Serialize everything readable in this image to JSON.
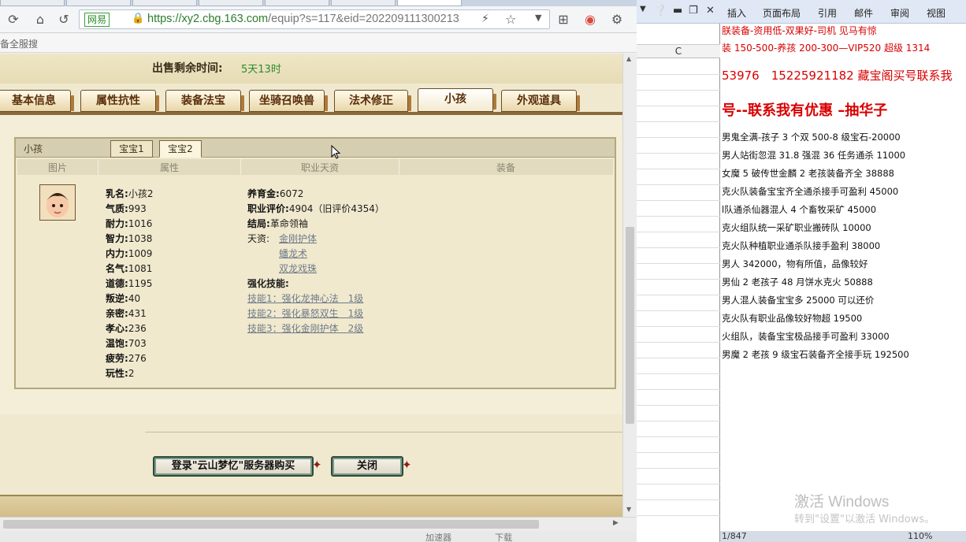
{
  "browser": {
    "url_site": "网易",
    "url_host": "https://xy2.cbg.163.com",
    "url_path": "/equip?s=117&eid=202209111300213",
    "fav_text": "备全服搜",
    "status_left": "加速器",
    "status_mid": "下载"
  },
  "sale": {
    "time_label": "出售剩余时间:",
    "time_value": "5天13时"
  },
  "tabs": [
    "基本信息",
    "属性抗性",
    "装备法宝",
    "坐骑召唤兽",
    "法术修正",
    "小孩",
    "外观道具"
  ],
  "panel": {
    "title": "小孩",
    "subtabs": [
      "宝宝1",
      "宝宝2"
    ],
    "columns": [
      "图片",
      "属性",
      "职业天资",
      "装备"
    ]
  },
  "child_attrs": [
    {
      "k": "乳名:",
      "v": "小孩2"
    },
    {
      "k": "气质:",
      "v": "993"
    },
    {
      "k": "耐力:",
      "v": "1016"
    },
    {
      "k": "智力:",
      "v": "1038"
    },
    {
      "k": "内力:",
      "v": "1009"
    },
    {
      "k": "名气:",
      "v": "1081"
    },
    {
      "k": "道德:",
      "v": "1195"
    },
    {
      "k": "叛逆:",
      "v": "40"
    },
    {
      "k": "亲密:",
      "v": "431"
    },
    {
      "k": "孝心:",
      "v": "236"
    },
    {
      "k": "温饱:",
      "v": "703"
    },
    {
      "k": "疲劳:",
      "v": "276"
    },
    {
      "k": "玩性:",
      "v": "2"
    }
  ],
  "career": {
    "raise_label": "养育金:",
    "raise_value": "6072",
    "eval_label": "职业评价:",
    "eval_value": "4904（旧评价4354）",
    "ending_label": "结局:",
    "ending_value": "革命领袖",
    "talent_label": "天资:",
    "talents": [
      "金刚护体",
      "蟠龙术",
      "双龙戏珠"
    ],
    "skills_label": "强化技能:",
    "skills": [
      "技能1：强化龙神心法　1级",
      "技能2：强化暴怒双生　1级",
      "技能3：强化金刚护体　2级"
    ]
  },
  "buttons": {
    "buy": "登录\"云山梦忆\"服务器购买",
    "close": "关闭"
  },
  "word": {
    "ribbon_tabs": [
      "插入",
      "页面布局",
      "引用",
      "邮件",
      "审阅",
      "视图"
    ],
    "col_label": "C",
    "red_line1": "朕装备-资用低-双果好-司机    见马有惊",
    "red_line2": "装 150-500-养孩 200-300—VIP520 超级 1314",
    "red_line3": "53976　15225921182 藏宝阁买号联系我",
    "big_title": "号--联系我有优惠 –抽华子",
    "lines": [
      "男鬼全满-孩子 3 个双 500-8 级宝石-20000",
      "男人站街忽混 31.8 强混 36 任务通杀 11000",
      "女魔 5 破传世金麟 2 老孩装备齐全 38888",
      "克火队装备宝宝齐全通杀接手可盈利 45000",
      "l队通杀仙器混人 4 个畜牧采矿 45000",
      "克火组队统一采矿职业搬砖队 10000",
      "克火队种植职业通杀队接手盈利 38000",
      "男人 342000，物有所值，品像较好",
      "男仙 2 老孩子 48 月饼水克火 50888",
      "男人混人装备宝宝多 25000 可以还价",
      "克火队有职业品像较好物超 19500",
      "火组队，装备宝宝极品接手可盈利 33000",
      "男魔 2 老孩 9 级宝石装备齐全接手玩 192500"
    ],
    "watermark1": "激活 Windows",
    "watermark2": "转到\"设置\"以激活 Windows。",
    "status_page": "1/847",
    "status_zoom": "110%"
  }
}
